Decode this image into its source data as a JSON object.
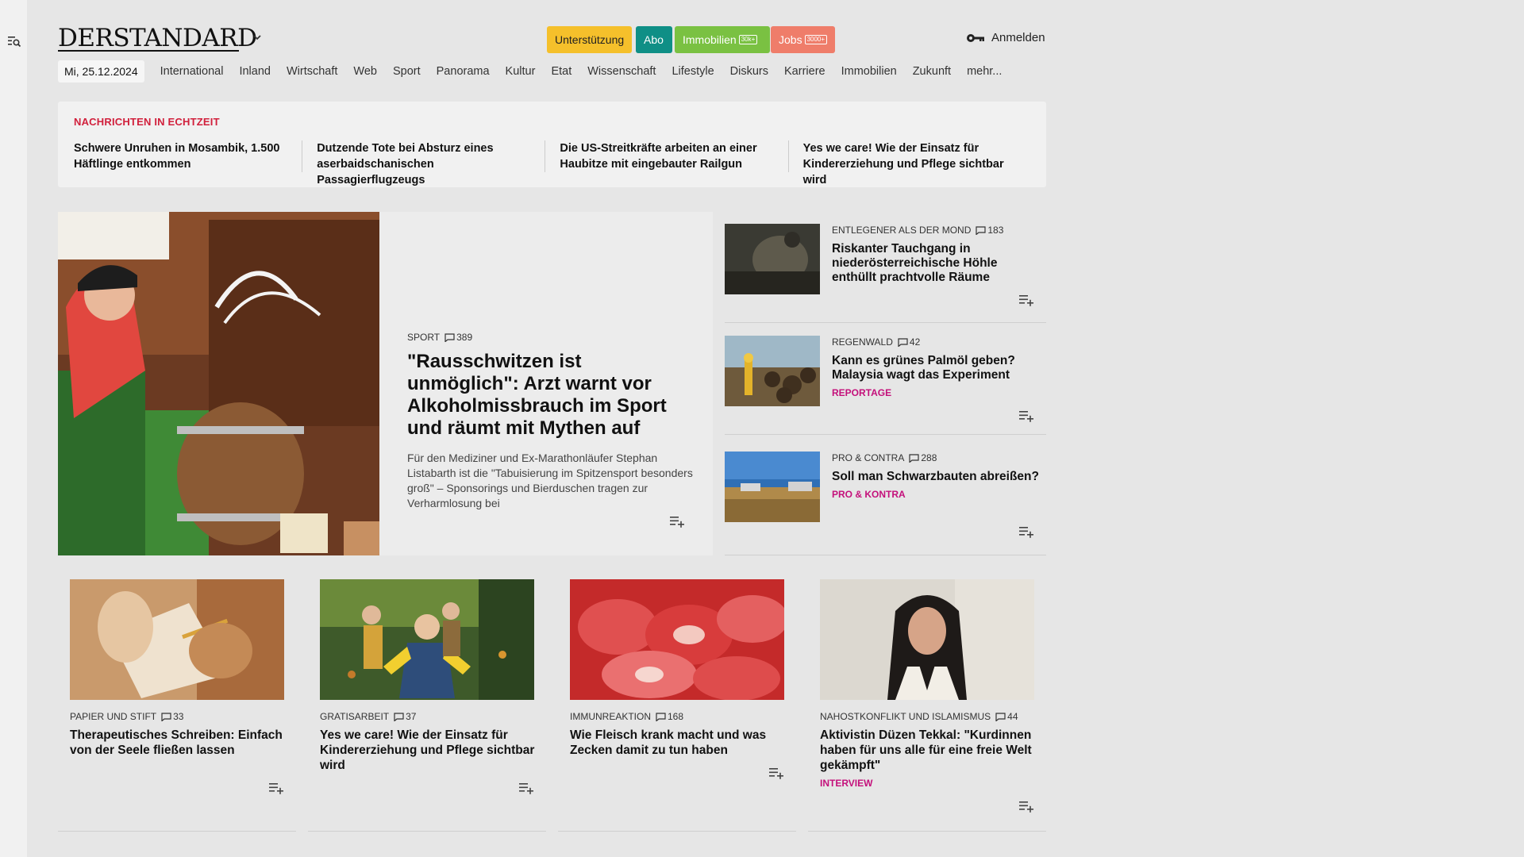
{
  "brand": {
    "logo": "DERSTANDARD"
  },
  "header": {
    "pills": [
      {
        "label": "Unterstützung"
      },
      {
        "label": "Abo"
      },
      {
        "label": "Immobilien",
        "badge": "30k+"
      },
      {
        "label": "Jobs",
        "badge": "3000+"
      }
    ],
    "login": "Anmelden"
  },
  "nav": {
    "date": "Mi, 25.12.2024",
    "items": [
      "International",
      "Inland",
      "Wirtschaft",
      "Web",
      "Sport",
      "Panorama",
      "Kultur",
      "Etat",
      "Wissenschaft",
      "Lifestyle",
      "Diskurs",
      "Karriere",
      "Immobilien",
      "Zukunft",
      "mehr..."
    ]
  },
  "ticker": {
    "label": "NACHRICHTEN IN ECHTZEIT",
    "items": [
      "Schwere Unruhen in Mosambik, 1.500 Häftlinge entkommen",
      "Dutzende Tote bei Absturz eines aserbaidschanischen Passagierflugzeugs",
      "Die US-Streitkräfte arbeiten an einer Haubitze mit eingebauter Railgun",
      "Yes we care! Wie der Einsatz für Kindererziehung und Pflege sichtbar wird"
    ]
  },
  "hero": {
    "kicker": "SPORT",
    "comments": "389",
    "title": "\"Rausschwitzen ist unmöglich\": Arzt warnt vor Alkoholmissbrauch im Sport und räumt mit Mythen auf",
    "teaser": "Für den Mediziner und Ex-Marathonläufer Stephan Listabarth ist die \"Tabuisierung im Spitzensport besonders groß\" – Sponsorings und Bierduschen tragen zur Verharmlosung bei"
  },
  "side": [
    {
      "kicker": "ENTLEGENER ALS DER MOND",
      "comments": "183",
      "title": "Riskanter Tauchgang in niederösterreichische Höhle enthüllt prachtvolle Räume",
      "tag": ""
    },
    {
      "kicker": "REGENWALD",
      "comments": "42",
      "title": "Kann es grünes Palmöl geben? Malaysia wagt das Experiment",
      "tag": "REPORTAGE"
    },
    {
      "kicker": "PRO & CONTRA",
      "comments": "288",
      "title": "Soll man Schwarzbauten abreißen?",
      "tag": "PRO & KONTRA"
    }
  ],
  "cards": [
    {
      "kicker": "PAPIER UND STIFT",
      "comments": "33",
      "title": "Therapeutisches Schreiben: Einfach von der Seele fließen lassen",
      "tag": ""
    },
    {
      "kicker": "GRATISARBEIT",
      "comments": "37",
      "title": "Yes we care! Wie der Einsatz für Kindererziehung und Pflege sichtbar wird",
      "tag": ""
    },
    {
      "kicker": "IMMUNREAKTION",
      "comments": "168",
      "title": "Wie Fleisch krank macht und was Zecken damit zu tun haben",
      "tag": ""
    },
    {
      "kicker": "NAHOSTKONFLIKT UND ISLAMISMUS",
      "comments": "44",
      "title": "Aktivistin Düzen Tekkal: \"Kurdinnen haben für uns alle für eine freie Welt gekämpft\"",
      "tag": "INTERVIEW"
    }
  ],
  "colors": {
    "accent_red": "#d1203c",
    "tag_magenta": "#c4107b",
    "support": "#f5c02b",
    "abo": "#0f8f86",
    "immobilien": "#7ac142",
    "jobs": "#ef7d6a"
  }
}
